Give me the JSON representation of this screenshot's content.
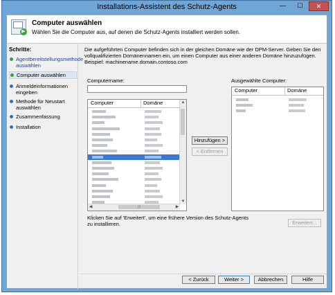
{
  "window": {
    "title": "Installations-Assistent des Schutz-Agents",
    "minimize_label": "—",
    "maximize_label": "☐",
    "close_label": "✕"
  },
  "header": {
    "title": "Computer auswählen",
    "subtitle": "Wählen Sie die Computer aus, auf denen die Schutz-Agents installiert werden sollen.",
    "icon": "computer-install-icon"
  },
  "sidebar": {
    "heading": "Schritte:",
    "steps": [
      {
        "label": "Agentbereitstellungsmethode auswählen",
        "state": "done"
      },
      {
        "label": "Computer auswählen",
        "state": "current"
      },
      {
        "label": "Anmeldeinformationen eingeben",
        "state": "pending"
      },
      {
        "label": "Methode für Neustart auswählen",
        "state": "pending"
      },
      {
        "label": "Zusammenfassung",
        "state": "pending"
      },
      {
        "label": "Installation",
        "state": "pending"
      }
    ]
  },
  "main": {
    "description": "Die aufgeführten Computer befinden sich in der gleichen Domäne wie der DPM-Server. Geben Sie den vollqualifizierten Domänennamen ein, um einen Computer aus einer anderen Domäne hinzuzufügen. Beispiel: machinename.domain.contoso.com",
    "computer_name_label": "Computername:",
    "computer_name_value": "",
    "available_list": {
      "col_computer": "Computer",
      "col_domain": "Domäne"
    },
    "selected_label": "Ausgewählte Computer:",
    "selected_list": {
      "col_computer": "Computer",
      "col_domain": "Domäne"
    },
    "add_button": "Hinzufügen >",
    "remove_button": "< Entfernen",
    "advanced_note": "Klicken Sie auf 'Erweitert', um eine frühere Version des Schutz-Agents zu installieren.",
    "advanced_button": "Erweitert..."
  },
  "footer": {
    "back": "< Zurück",
    "next": "Weiter >",
    "cancel": "Abbrechen",
    "help": "Hilfe"
  }
}
